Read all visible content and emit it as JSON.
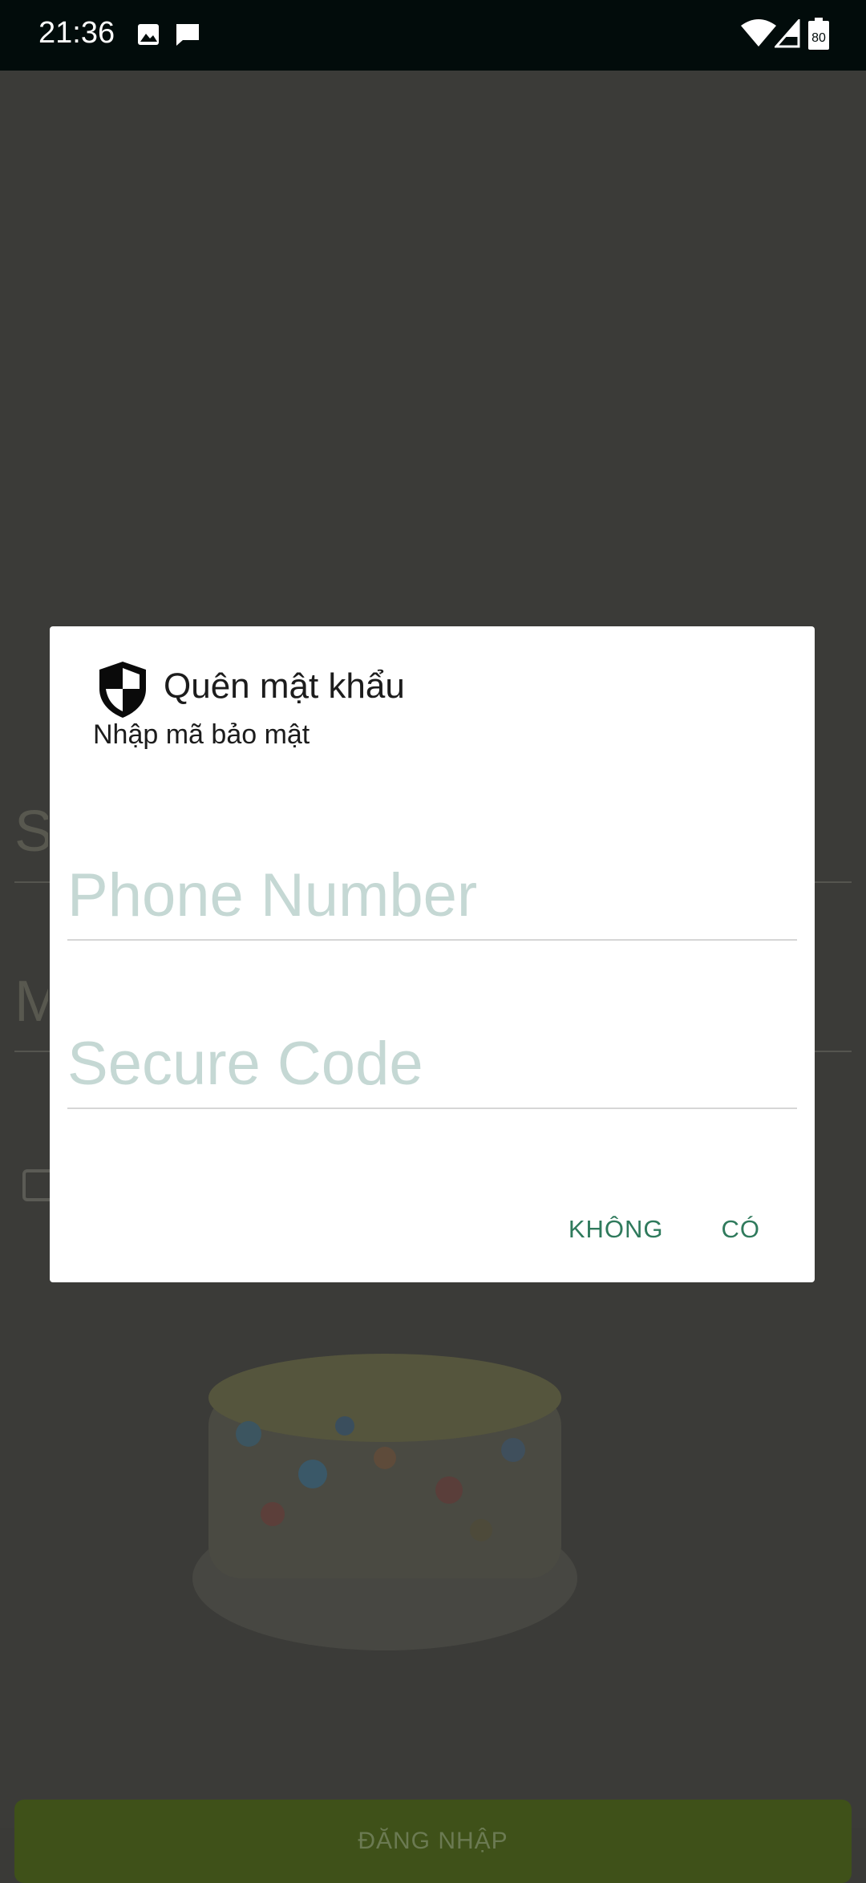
{
  "status_bar": {
    "time": "21:36",
    "left_icons": [
      "image-icon",
      "message-icon"
    ],
    "right_icons": [
      "wifi-icon",
      "signal-icon",
      "battery-icon"
    ],
    "battery_level": "80"
  },
  "background": {
    "field1_partial": "S",
    "field2_partial": "M",
    "login_button_label": "ĐĂNG NHẬP"
  },
  "dialog": {
    "icon": "shield-icon",
    "title": "Quên mật khẩu",
    "subtitle": "Nhập mã bảo mật",
    "phone_placeholder": "Phone Number",
    "phone_value": "",
    "code_placeholder": "Secure Code",
    "code_value": "",
    "negative_label": "KHÔNG",
    "positive_label": "CÓ"
  }
}
